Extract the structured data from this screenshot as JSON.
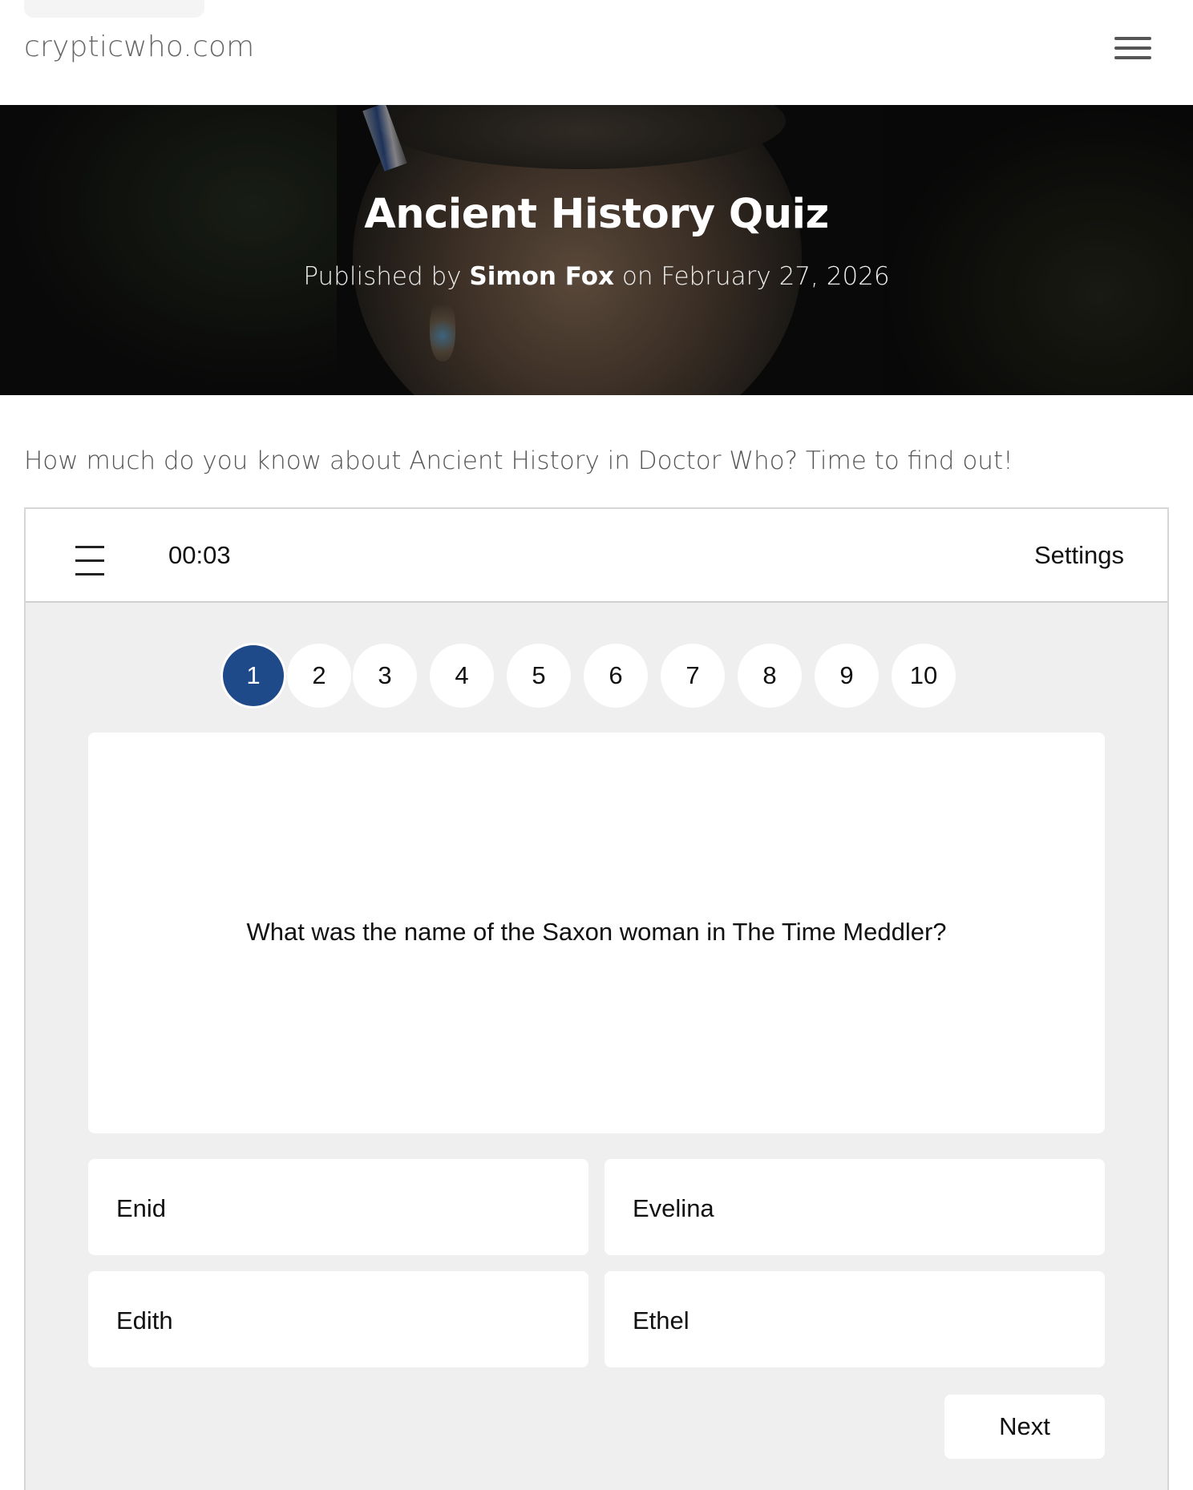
{
  "site": {
    "name": "crypticwho.com"
  },
  "hero": {
    "title": "Ancient History Quiz",
    "published_prefix": "Published by",
    "author": "Simon Fox",
    "date_text": "on February 27, 2026"
  },
  "intro": "How much do you know about Ancient History in Doctor Who? Time to find out!",
  "quiz": {
    "timer": "00:03",
    "settings_label": "Settings",
    "question_numbers": [
      "1",
      "2",
      "3",
      "4",
      "5",
      "6",
      "7",
      "8",
      "9",
      "10"
    ],
    "current_question": "1",
    "question": "What was the name of the Saxon woman in The Time Meddler?",
    "answers": [
      "Enid",
      "Evelina",
      "Edith",
      "Ethel"
    ],
    "next_label": "Next"
  },
  "colors": {
    "accent": "#1f4a8a",
    "quiz_background": "#efefef"
  },
  "icons": {
    "site_menu": "hamburger-menu-icon",
    "quiz_menu": "hamburger-menu-icon"
  }
}
